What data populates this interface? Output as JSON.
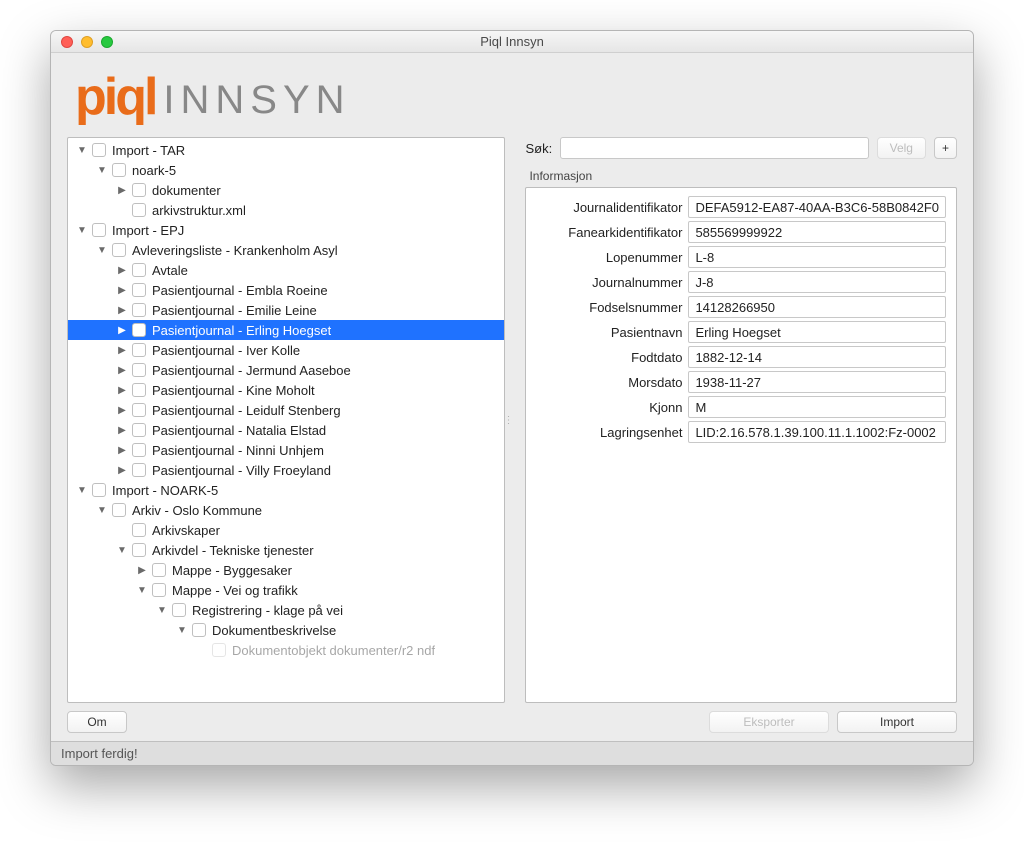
{
  "window": {
    "title": "Piql Innsyn"
  },
  "logo": {
    "word1": "piql",
    "word2": "INNSYN"
  },
  "search": {
    "label": "Søk:",
    "placeholder": "",
    "value": "",
    "choose": "Velg",
    "plus": "+"
  },
  "info": {
    "section_title": "Informasjon",
    "fields": [
      {
        "label": "Journalidentifikator",
        "value": "DEFA5912-EA87-40AA-B3C6-58B0842F0"
      },
      {
        "label": "Fanearkidentifikator",
        "value": "585569999922"
      },
      {
        "label": "Lopenummer",
        "value": "L-8"
      },
      {
        "label": "Journalnummer",
        "value": "J-8"
      },
      {
        "label": "Fodselsnummer",
        "value": "14128266950"
      },
      {
        "label": "Pasientnavn",
        "value": "Erling Hoegset"
      },
      {
        "label": "Fodtdato",
        "value": "1882-12-14"
      },
      {
        "label": "Morsdato",
        "value": "1938-11-27"
      },
      {
        "label": "Kjonn",
        "value": "M"
      },
      {
        "label": "Lagringsenhet",
        "value": "LID:2.16.578.1.39.100.11.1.1002:Fz-0002"
      }
    ]
  },
  "buttons": {
    "about": "Om",
    "export": "Eksporter",
    "import": "Import"
  },
  "status": "Import ferdig!",
  "tree": [
    {
      "depth": 0,
      "arrow": "▼",
      "label": "Import - TAR",
      "checkbox": true
    },
    {
      "depth": 1,
      "arrow": "▼",
      "label": "noark-5",
      "checkbox": true
    },
    {
      "depth": 2,
      "arrow": "▶",
      "label": "dokumenter",
      "checkbox": true
    },
    {
      "depth": 2,
      "arrow": "",
      "label": "arkivstruktur.xml",
      "checkbox": true
    },
    {
      "depth": 0,
      "arrow": "▼",
      "label": "Import - EPJ",
      "checkbox": true
    },
    {
      "depth": 1,
      "arrow": "▼",
      "label": "Avleveringsliste - Krankenholm Asyl",
      "checkbox": true
    },
    {
      "depth": 2,
      "arrow": "▶",
      "label": "Avtale",
      "checkbox": true
    },
    {
      "depth": 2,
      "arrow": "▶",
      "label": "Pasientjournal - Embla Roeine",
      "checkbox": true
    },
    {
      "depth": 2,
      "arrow": "▶",
      "label": "Pasientjournal - Emilie Leine",
      "checkbox": true
    },
    {
      "depth": 2,
      "arrow": "▶",
      "label": "Pasientjournal - Erling Hoegset",
      "checkbox": true,
      "selected": true
    },
    {
      "depth": 2,
      "arrow": "▶",
      "label": "Pasientjournal - Iver Kolle",
      "checkbox": true
    },
    {
      "depth": 2,
      "arrow": "▶",
      "label": "Pasientjournal - Jermund Aaseboe",
      "checkbox": true
    },
    {
      "depth": 2,
      "arrow": "▶",
      "label": "Pasientjournal - Kine Moholt",
      "checkbox": true
    },
    {
      "depth": 2,
      "arrow": "▶",
      "label": "Pasientjournal - Leidulf Stenberg",
      "checkbox": true
    },
    {
      "depth": 2,
      "arrow": "▶",
      "label": "Pasientjournal - Natalia Elstad",
      "checkbox": true
    },
    {
      "depth": 2,
      "arrow": "▶",
      "label": "Pasientjournal - Ninni Unhjem",
      "checkbox": true
    },
    {
      "depth": 2,
      "arrow": "▶",
      "label": "Pasientjournal - Villy Froeyland",
      "checkbox": true
    },
    {
      "depth": 0,
      "arrow": "▼",
      "label": "Import - NOARK-5",
      "checkbox": true
    },
    {
      "depth": 1,
      "arrow": "▼",
      "label": "Arkiv - Oslo Kommune",
      "checkbox": true
    },
    {
      "depth": 2,
      "arrow": "",
      "label": "Arkivskaper",
      "checkbox": true
    },
    {
      "depth": 2,
      "arrow": "▼",
      "label": "Arkivdel - Tekniske tjenester",
      "checkbox": true
    },
    {
      "depth": 3,
      "arrow": "▶",
      "label": "Mappe - Byggesaker",
      "checkbox": true
    },
    {
      "depth": 3,
      "arrow": "▼",
      "label": "Mappe - Vei og trafikk",
      "checkbox": true
    },
    {
      "depth": 4,
      "arrow": "▼",
      "label": "Registrering - klage på vei",
      "checkbox": true
    },
    {
      "depth": 5,
      "arrow": "▼",
      "label": "Dokumentbeskrivelse",
      "checkbox": true
    },
    {
      "depth": 6,
      "arrow": "",
      "label": "Dokumentobjekt   dokumenter/r2 ndf",
      "checkbox": true,
      "cutoff": true
    }
  ]
}
